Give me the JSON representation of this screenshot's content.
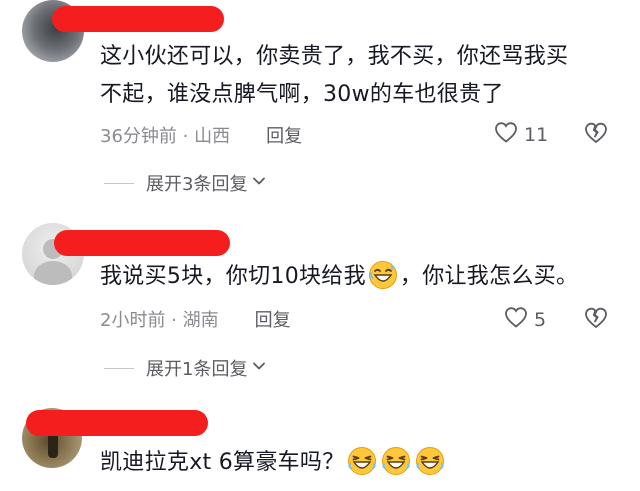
{
  "comments": [
    {
      "text_line1": "这小伙还可以，你卖贵了，我不买，你还骂我买",
      "text_line2": "不起，谁没点脾气啊，30w的车也很贵了",
      "time": "36分钟前",
      "location": "山西",
      "reply_label": "回复",
      "likes": "11",
      "expand_label": "展开3条回复"
    },
    {
      "text_before_emoji": "我说买5块，你切10块给我",
      "text_after_emoji": "，你让我怎么买。",
      "time": "2小时前",
      "location": "湖南",
      "reply_label": "回复",
      "likes": "5",
      "expand_label": "展开1条回复"
    },
    {
      "text": "凯迪拉克xt 6算豪车吗？"
    }
  ],
  "separator": " · ",
  "colors": {
    "redaction": "#f41e1e",
    "text_primary": "#161823",
    "text_meta": "#8a8b91",
    "icon": "#5c5d63"
  },
  "icons": {
    "like": "heart-outline-icon",
    "dislike": "broken-heart-icon",
    "expand": "chevron-down-icon",
    "emoji_sweat": "laughing-sweat-emoji",
    "emoji_laugh": "laughing-emoji"
  }
}
